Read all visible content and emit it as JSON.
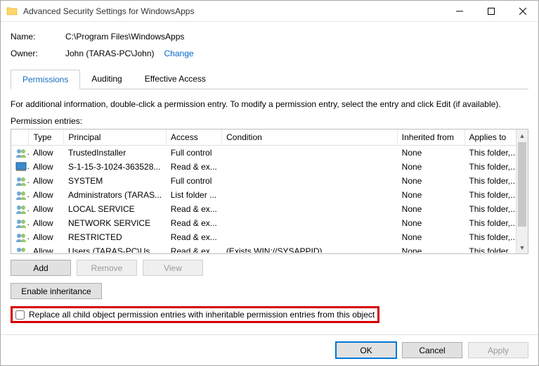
{
  "window": {
    "title": "Advanced Security Settings for WindowsApps"
  },
  "fields": {
    "name_label": "Name:",
    "name_value": "C:\\Program Files\\WindowsApps",
    "owner_label": "Owner:",
    "owner_value": "John (TARAS-PC\\John)",
    "change_link": "Change"
  },
  "tabs": {
    "permissions": "Permissions",
    "auditing": "Auditing",
    "effective": "Effective Access"
  },
  "hint": "For additional information, double-click a permission entry. To modify a permission entry, select the entry and click Edit (if available).",
  "entries_label": "Permission entries:",
  "columns": {
    "type": "Type",
    "principal": "Principal",
    "access": "Access",
    "condition": "Condition",
    "inherited": "Inherited from",
    "applies": "Applies to"
  },
  "rows": [
    {
      "icon": "group",
      "type": "Allow",
      "principal": "TrustedInstaller",
      "access": "Full control",
      "condition": "",
      "inherited": "None",
      "applies": "This folder,..."
    },
    {
      "icon": "app",
      "type": "Allow",
      "principal": "S-1-15-3-1024-363528...",
      "access": "Read & ex...",
      "condition": "",
      "inherited": "None",
      "applies": "This folder,..."
    },
    {
      "icon": "group",
      "type": "Allow",
      "principal": "SYSTEM",
      "access": "Full control",
      "condition": "",
      "inherited": "None",
      "applies": "This folder,..."
    },
    {
      "icon": "group",
      "type": "Allow",
      "principal": "Administrators (TARAS...",
      "access": "List folder ...",
      "condition": "",
      "inherited": "None",
      "applies": "This folder,..."
    },
    {
      "icon": "group",
      "type": "Allow",
      "principal": "LOCAL SERVICE",
      "access": "Read & ex...",
      "condition": "",
      "inherited": "None",
      "applies": "This folder,..."
    },
    {
      "icon": "group",
      "type": "Allow",
      "principal": "NETWORK SERVICE",
      "access": "Read & ex...",
      "condition": "",
      "inherited": "None",
      "applies": "This folder,..."
    },
    {
      "icon": "group",
      "type": "Allow",
      "principal": "RESTRICTED",
      "access": "Read & ex...",
      "condition": "",
      "inherited": "None",
      "applies": "This folder,..."
    },
    {
      "icon": "group",
      "type": "Allow",
      "principal": "Users (TARAS-PC\\Users)",
      "access": "Read & ex...",
      "condition": "(Exists WIN://SYSAPPID)",
      "inherited": "None",
      "applies": "This folder,..."
    }
  ],
  "buttons": {
    "add": "Add",
    "remove": "Remove",
    "view": "View",
    "enable_inheritance": "Enable inheritance",
    "ok": "OK",
    "cancel": "Cancel",
    "apply": "Apply"
  },
  "checkbox_label": "Replace all child object permission entries with inheritable permission entries from this object"
}
